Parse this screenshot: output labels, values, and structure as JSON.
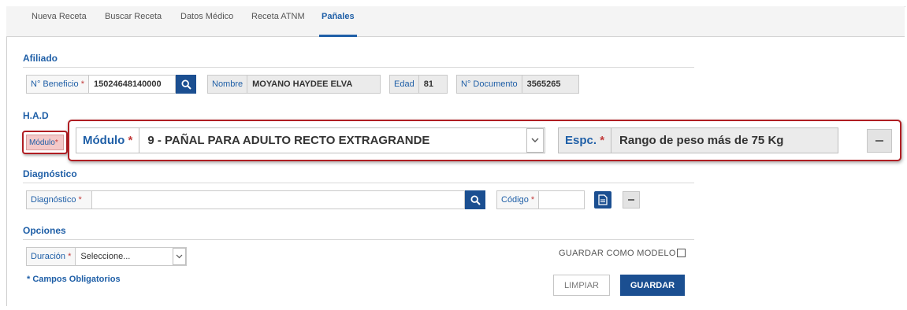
{
  "tabs": [
    {
      "label": "Nueva Receta"
    },
    {
      "label": "Buscar Receta"
    },
    {
      "label": "Datos Médico"
    },
    {
      "label": "Receta ATNM"
    },
    {
      "label": "Pañales"
    }
  ],
  "afiliado": {
    "title": "Afiliado",
    "beneficio_label": "N° Beneficio",
    "beneficio_value": "15024648140000",
    "nombre_label": "Nombre",
    "nombre_value": "MOYANO HAYDEE ELVA",
    "edad_label": "Edad",
    "edad_value": "81",
    "documento_label": "N° Documento",
    "documento_value": "3565265"
  },
  "had": {
    "title": "H.A.D",
    "modulo_small_label": "Módulo",
    "modulo_label": "Módulo",
    "modulo_value": "9 - PAÑAL PARA ADULTO RECTO EXTRAGRANDE",
    "espc_label": "Espc.",
    "espc_value": "Rango de peso más de 75 Kg"
  },
  "diagnostico": {
    "title": "Diagnóstico",
    "diagnostico_label": "Diagnóstico",
    "diagnostico_value": "",
    "codigo_label": "Código",
    "codigo_value": ""
  },
  "opciones": {
    "title": "Opciones",
    "duracion_label": "Duración",
    "duracion_value": "Seleccione...",
    "guardar_modelo_label": "GUARDAR COMO MODELO"
  },
  "footer": {
    "required_note": "* Campos Obligatorios",
    "limpiar_label": "LIMPIAR",
    "guardar_label": "GUARDAR"
  },
  "required_mark": "*",
  "colors": {
    "accent": "#1f5fa7",
    "button": "#1b4f91",
    "highlight": "#b01e23"
  },
  "icons": {
    "search": "search-icon",
    "document": "document-icon",
    "minus": "minus-icon",
    "chevron": "chevron-down-icon"
  }
}
